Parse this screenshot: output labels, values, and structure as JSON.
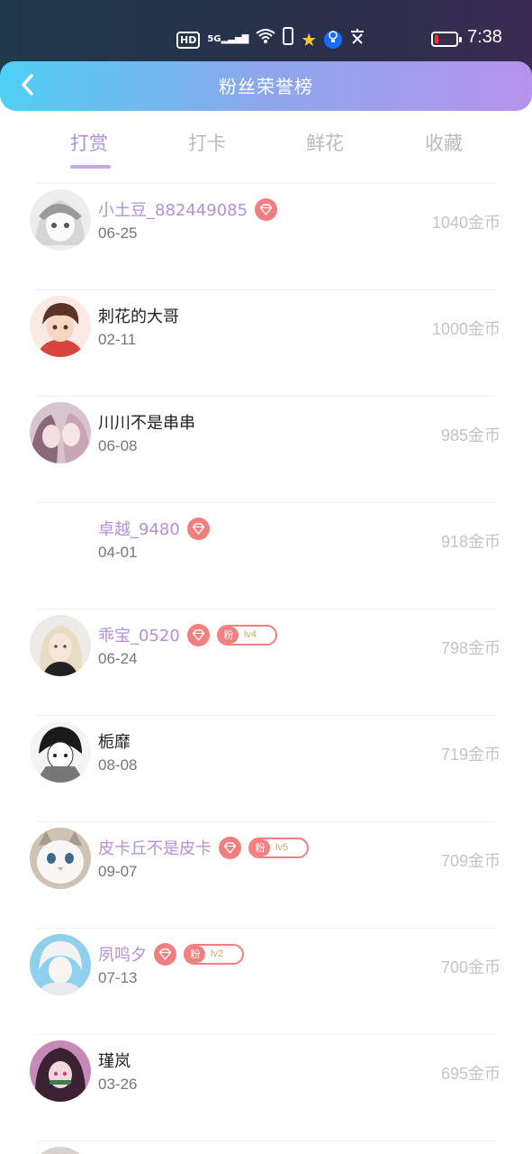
{
  "status": {
    "hd": "HD",
    "signal": "5G",
    "time": "7:38",
    "icons": [
      "hd-icon",
      "signal-icon",
      "wifi-icon",
      "phone-icon",
      "star-icon",
      "bulb-icon",
      "wen-icon"
    ],
    "battery_color": "#ff2e2e"
  },
  "header": {
    "title": "粉丝荣誉榜",
    "back_icon": "chevron-left-icon"
  },
  "tabs": [
    {
      "label": "打赏",
      "active": true
    },
    {
      "label": "打卡",
      "active": false
    },
    {
      "label": "鲜花",
      "active": false
    },
    {
      "label": "收藏",
      "active": false
    }
  ],
  "colors": {
    "accent": "#b68fd8",
    "badge": "#f27f7f",
    "muted": "#c4c4c4"
  },
  "rows": [
    {
      "name": "小土豆_882449085",
      "vip": true,
      "gem": true,
      "fan": null,
      "date": "06-25",
      "coins": "1040金币",
      "avatar": "anime-girl-sketch"
    },
    {
      "name": "刺花的大哥",
      "vip": false,
      "gem": false,
      "fan": null,
      "date": "02-11",
      "coins": "1000金币",
      "avatar": "anime-boy"
    },
    {
      "name": "川川不是串串",
      "vip": false,
      "gem": false,
      "fan": null,
      "date": "06-08",
      "coins": "985金币",
      "avatar": "anime-couple"
    },
    {
      "name": "卓越_9480",
      "vip": true,
      "gem": true,
      "fan": null,
      "date": "04-01",
      "coins": "918金币",
      "avatar": "none"
    },
    {
      "name": "乖宝_0520",
      "vip": true,
      "gem": true,
      "fan": {
        "label": "粉",
        "level": "lv4"
      },
      "date": "06-24",
      "coins": "798金币",
      "avatar": "blonde-girl"
    },
    {
      "name": "栀靡",
      "vip": false,
      "gem": false,
      "fan": null,
      "date": "08-08",
      "coins": "719金币",
      "avatar": "manga-girl"
    },
    {
      "name": "皮卡丘不是皮卡",
      "vip": true,
      "gem": true,
      "fan": {
        "label": "粉",
        "level": "lv5"
      },
      "date": "09-07",
      "coins": "709金币",
      "avatar": "white-cat"
    },
    {
      "name": "夙鸣夕",
      "vip": true,
      "gem": true,
      "fan": {
        "label": "粉",
        "level": "lv2"
      },
      "date": "07-13",
      "coins": "700金币",
      "avatar": "anime-white-hair"
    },
    {
      "name": "瑾岚",
      "vip": false,
      "gem": false,
      "fan": null,
      "date": "03-26",
      "coins": "695金币",
      "avatar": "anime-pink"
    }
  ]
}
